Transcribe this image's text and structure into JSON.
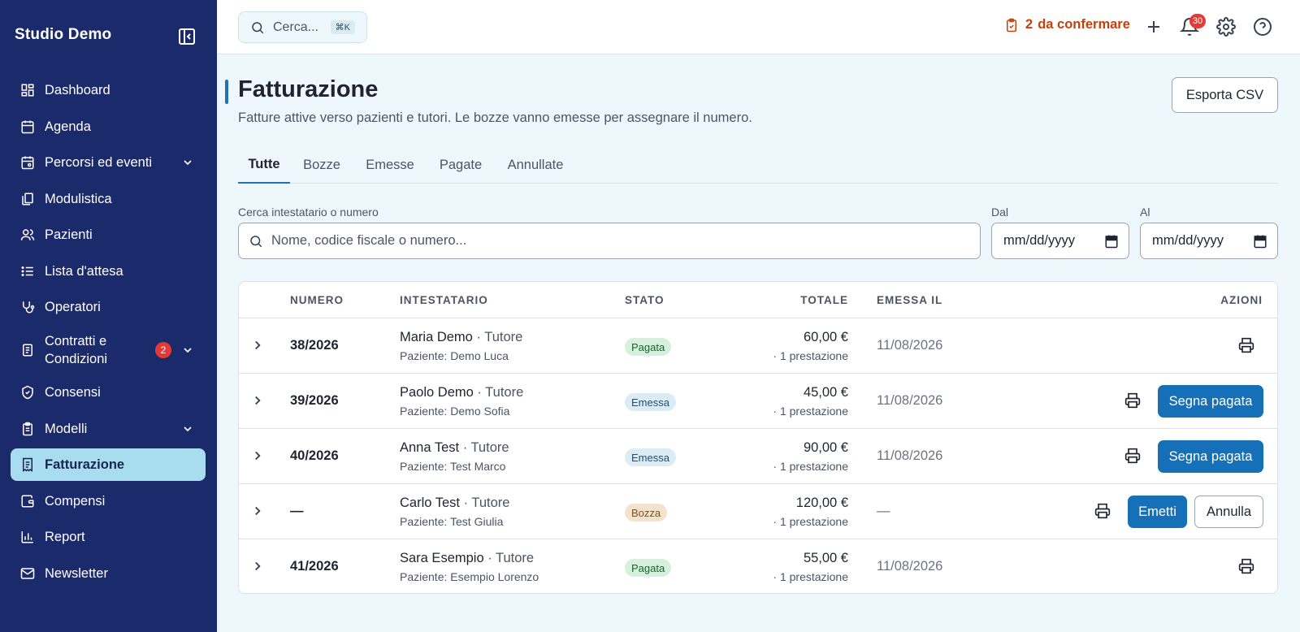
{
  "app": {
    "name": "Studio Demo"
  },
  "sidebar": {
    "items": [
      {
        "label": "Dashboard"
      },
      {
        "label": "Agenda"
      },
      {
        "label": "Percorsi ed eventi"
      },
      {
        "label": "Modulistica"
      },
      {
        "label": "Pazienti"
      },
      {
        "label": "Lista d'attesa"
      },
      {
        "label": "Operatori"
      },
      {
        "label": "Contratti e Condizioni",
        "badge": "2"
      },
      {
        "label": "Consensi"
      },
      {
        "label": "Modelli"
      },
      {
        "label": "Fatturazione"
      },
      {
        "label": "Compensi"
      },
      {
        "label": "Report"
      },
      {
        "label": "Newsletter"
      }
    ]
  },
  "topbar": {
    "search_placeholder": "Cerca...",
    "search_shortcut": "⌘K",
    "pending_count": "2",
    "pending_label": "da confermare",
    "notifications_count": "30"
  },
  "page": {
    "title": "Fatturazione",
    "subtitle": "Fatture attive verso pazienti e tutori. Le bozze vanno emesse per assegnare il numero.",
    "export_label": "Esporta CSV"
  },
  "tabs": [
    {
      "label": "Tutte",
      "active": true
    },
    {
      "label": "Bozze"
    },
    {
      "label": "Emesse"
    },
    {
      "label": "Pagate"
    },
    {
      "label": "Annullate"
    }
  ],
  "filters": {
    "search_label": "Cerca intestatario o numero",
    "search_placeholder": "Nome, codice fiscale o numero...",
    "from_label": "Dal",
    "to_label": "Al",
    "date_placeholder": "mm/dd/yyyy"
  },
  "table": {
    "columns": {
      "number": "NUMERO",
      "holder": "INTESTATARIO",
      "status": "STATO",
      "total": "TOTALE",
      "issued_on": "EMESSA IL",
      "actions": "AZIONI"
    },
    "rows": [
      {
        "number": "38/2026",
        "holder": "Maria Demo",
        "role": "· Tutore",
        "patient": "Paziente: Demo Luca",
        "status": "Pagata",
        "total": "60,00 €",
        "services": "· 1 prestazione",
        "issued_on": "11/08/2026"
      },
      {
        "number": "39/2026",
        "holder": "Paolo Demo",
        "role": "· Tutore",
        "patient": "Paziente: Demo Sofia",
        "status": "Emessa",
        "total": "45,00 €",
        "services": "· 1 prestazione",
        "issued_on": "11/08/2026",
        "action": "Segna pagata"
      },
      {
        "number": "40/2026",
        "holder": "Anna Test",
        "role": "· Tutore",
        "patient": "Paziente: Test Marco",
        "status": "Emessa",
        "total": "90,00 €",
        "services": "· 1 prestazione",
        "issued_on": "11/08/2026",
        "action": "Segna pagata"
      },
      {
        "number": "—",
        "holder": "Carlo Test",
        "role": "· Tutore",
        "patient": "Paziente: Test Giulia",
        "status": "Bozza",
        "total": "120,00 €",
        "services": "· 1 prestazione",
        "issued_on": "—",
        "action": "Emetti",
        "secondary_action": "Annulla"
      },
      {
        "number": "41/2026",
        "holder": "Sara Esempio",
        "role": "· Tutore",
        "patient": "Paziente: Esempio Lorenzo",
        "status": "Pagata",
        "total": "55,00 €",
        "services": "· 1 prestazione",
        "issued_on": "11/08/2026"
      }
    ]
  },
  "colors": {
    "sidebar_bg": "#1b2a6b",
    "active_nav_bg": "#a8dcef",
    "primary": "#1670b8",
    "page_bg": "#eef8fc",
    "badge_red": "#e53935",
    "pending_orange": "#c2410c"
  }
}
